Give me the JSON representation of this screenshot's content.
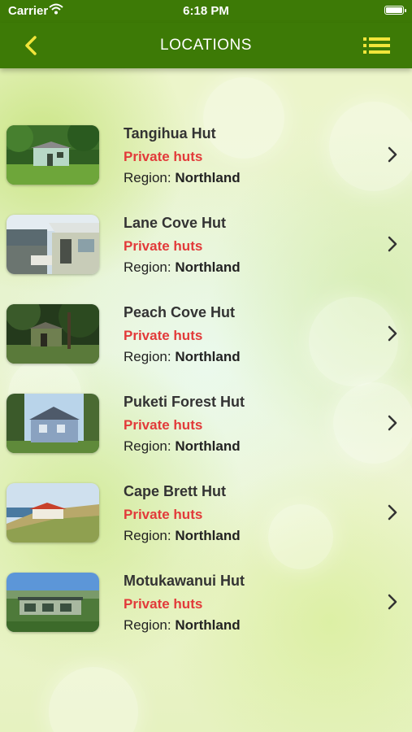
{
  "status_bar": {
    "carrier": "Carrier",
    "time": "6:18 PM"
  },
  "nav": {
    "title": "LOCATIONS",
    "back_icon": "chevron-left-icon",
    "menu_icon": "list-icon",
    "accent_color": "#f1e53a",
    "bar_color": "#3d7a06"
  },
  "locations": [
    {
      "name": "Tangihua Hut",
      "category": "Private huts",
      "region_label": "Region:",
      "region": "Northland"
    },
    {
      "name": "Lane Cove Hut",
      "category": "Private huts",
      "region_label": "Region:",
      "region": "Northland"
    },
    {
      "name": "Peach Cove Hut",
      "category": "Private huts",
      "region_label": "Region:",
      "region": "Northland"
    },
    {
      "name": "Puketi Forest Hut",
      "category": "Private huts",
      "region_label": "Region:",
      "region": "Northland"
    },
    {
      "name": "Cape Brett Hut",
      "category": "Private huts",
      "region_label": "Region:",
      "region": "Northland"
    },
    {
      "name": "Motukawanui Hut",
      "category": "Private huts",
      "region_label": "Region:",
      "region": "Northland"
    }
  ],
  "colors": {
    "category": "#e23a3a",
    "name": "#333333"
  }
}
